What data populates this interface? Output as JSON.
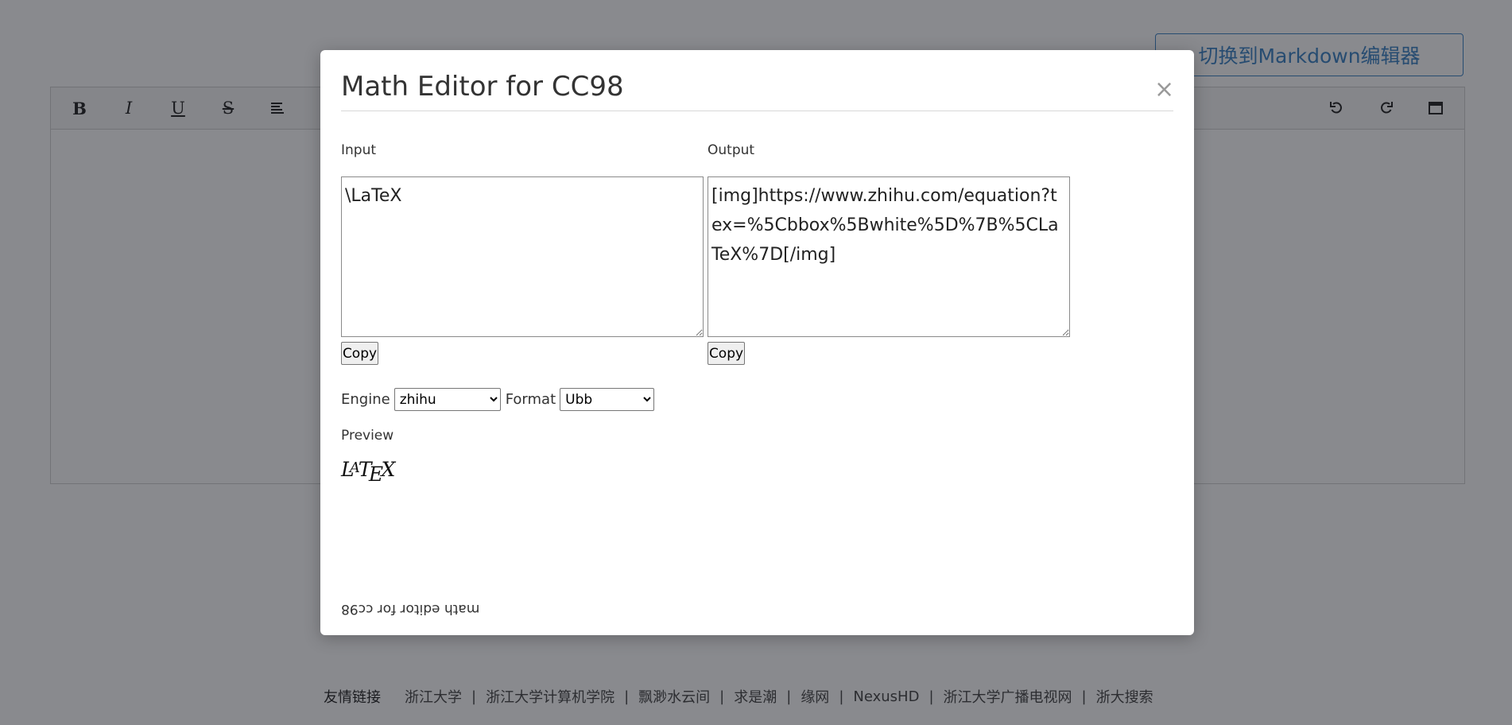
{
  "background": {
    "switch_button": "切换到Markdown编辑器",
    "toolbar": {
      "left": [
        {
          "icon": "bold-icon",
          "glyph": "B"
        },
        {
          "icon": "italic-icon",
          "glyph": "I"
        },
        {
          "icon": "underline-icon",
          "glyph": "U"
        },
        {
          "icon": "strikethrough-icon",
          "glyph": "S"
        },
        {
          "icon": "align-left-icon",
          "glyph": ""
        }
      ],
      "right": [
        {
          "icon": "undo-icon"
        },
        {
          "icon": "redo-icon"
        },
        {
          "icon": "fullscreen-icon"
        }
      ]
    },
    "footer": {
      "label": "友情链接",
      "links": [
        "浙江大学",
        "浙江大学计算机学院",
        "飘渺水云间",
        "求是潮",
        "缘网",
        "NexusHD",
        "浙江大学广播电视网",
        "浙大搜索"
      ],
      "separator": "|"
    }
  },
  "modal": {
    "title": "Math Editor for CC98",
    "close_glyph": "×",
    "input": {
      "label": "Input",
      "value": "\\LaTeX",
      "copy_label": "Copy"
    },
    "output": {
      "label": "Output",
      "value": "[img]https://www.zhihu.com/equation?tex=%5Cbbox%5Bwhite%5D%7B%5CLaTeX%7D[/img]",
      "copy_label": "Copy"
    },
    "engine": {
      "label": "Engine",
      "selected": "zhihu"
    },
    "format": {
      "label": "Format",
      "selected": "Ubb"
    },
    "preview": {
      "label": "Preview",
      "math": {
        "L": "L",
        "A": "A",
        "T": "T",
        "E": "E",
        "X": "X"
      }
    },
    "footer_text": "math editor for cc98"
  },
  "colors": {
    "overlay": "rgba(20,22,30,0.5)",
    "accent": "#3b82c4",
    "close": "#9a9a9a"
  }
}
